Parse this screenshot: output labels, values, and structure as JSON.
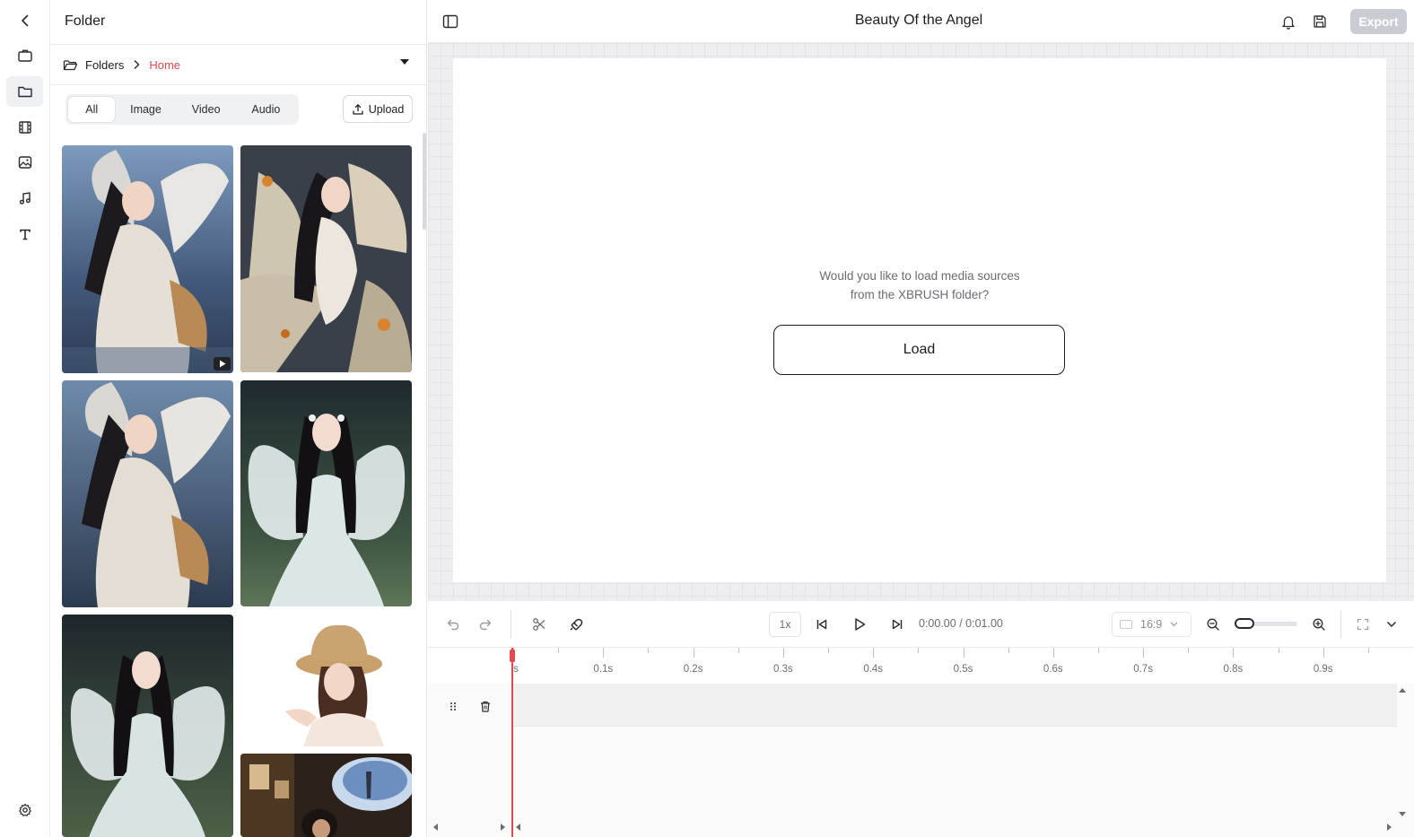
{
  "left_rail": {
    "items": [
      {
        "name": "back-icon"
      },
      {
        "name": "briefcase-icon"
      },
      {
        "name": "folder-icon",
        "active": true
      },
      {
        "name": "film-icon"
      },
      {
        "name": "image-icon"
      },
      {
        "name": "music-icon"
      },
      {
        "name": "text-icon"
      },
      {
        "name": "settings-icon"
      }
    ]
  },
  "panel": {
    "title": "Folder",
    "breadcrumb": {
      "root": "Folders",
      "current": "Home"
    },
    "filters": [
      "All",
      "Image",
      "Video",
      "Audio"
    ],
    "active_filter": "All",
    "upload_label": "Upload",
    "thumbnails": [
      {
        "name": "thumb-angel-wings-sitting",
        "is_video": true
      },
      {
        "name": "thumb-angel-gold-wings"
      },
      {
        "name": "thumb-angel-wings-sitting-2"
      },
      {
        "name": "thumb-fairy-butterfly-wings"
      },
      {
        "name": "thumb-fairy-butterfly-wings-2"
      },
      {
        "name": "thumb-girl-straw-hat"
      },
      {
        "name": "thumb-girl-dream-cloud"
      }
    ]
  },
  "topbar": {
    "title": "Beauty Of the Angel",
    "export_label": "Export",
    "icons": [
      "sidebar-toggle-icon",
      "bell-icon",
      "save-icon"
    ]
  },
  "canvas": {
    "prompt_line1": "Would you like to load media sources",
    "prompt_line2": "from the XBRUSH folder?",
    "load_label": "Load"
  },
  "timeline": {
    "speed": "1x",
    "current_time": "0:00.00",
    "separator": " / ",
    "total_time": "0:01.00",
    "aspect_ratio": "16:9",
    "zoom_level": 0.1,
    "ruler_labels": [
      "s",
      "0.1s",
      "0.2s",
      "0.3s",
      "0.4s",
      "0.5s",
      "0.6s",
      "0.7s",
      "0.8s",
      "0.9s"
    ]
  },
  "colors": {
    "accent": "#e5484d",
    "export_disabled": "#c9ccd3",
    "text": "#1c1c22",
    "muted": "#6b6b74"
  }
}
